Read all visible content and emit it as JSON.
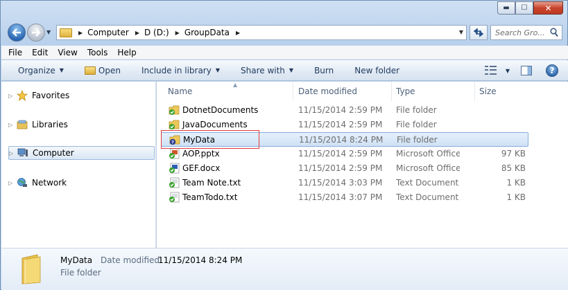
{
  "window": {
    "controls": {
      "minimize": "▬",
      "maximize": "☐",
      "close": "✕"
    }
  },
  "address": {
    "crumbs": [
      "Computer",
      "D (D:)",
      "GroupData"
    ]
  },
  "search": {
    "placeholder": "Search Gro..."
  },
  "menu": [
    "File",
    "Edit",
    "View",
    "Tools",
    "Help"
  ],
  "toolbar": {
    "organize": "Organize",
    "open": "Open",
    "include_in_library": "Include in library",
    "share_with": "Share with",
    "burn": "Burn",
    "new_folder": "New folder"
  },
  "nav_pane": {
    "items": [
      "Favorites",
      "Libraries",
      "Computer",
      "Network"
    ],
    "selected": "Computer"
  },
  "columns": {
    "name": "Name",
    "date": "Date modified",
    "type": "Type",
    "size": "Size"
  },
  "files": [
    {
      "name": "DotnetDocuments",
      "date": "11/15/2014 2:59 PM",
      "type": "File folder",
      "size": "",
      "icon": "folder-check-icon"
    },
    {
      "name": "JavaDocuments",
      "date": "11/15/2014 2:59 PM",
      "type": "File folder",
      "size": "",
      "icon": "folder-check-icon"
    },
    {
      "name": "MyData",
      "date": "11/15/2014 8:24 PM",
      "type": "File folder",
      "size": "",
      "icon": "folder-question-icon"
    },
    {
      "name": "AOP.pptx",
      "date": "11/15/2014 2:59 PM",
      "type": "Microsoft Office P...",
      "size": "97 KB",
      "icon": "pptx-check-icon"
    },
    {
      "name": "GEF.docx",
      "date": "11/15/2014 2:59 PM",
      "type": "Microsoft Office ...",
      "size": "85 KB",
      "icon": "docx-check-icon"
    },
    {
      "name": "Team Note.txt",
      "date": "11/15/2014 3:03 PM",
      "type": "Text Document",
      "size": "1 KB",
      "icon": "txt-check-icon"
    },
    {
      "name": "TeamTodo.txt",
      "date": "11/15/2014 3:07 PM",
      "type": "Text Document",
      "size": "1 KB",
      "icon": "txt-check-icon"
    }
  ],
  "details": {
    "name": "MyData",
    "date_label": "Date modified:",
    "date_value": "11/15/2014 8:24 PM",
    "type": "File folder"
  },
  "colors": {
    "accent": "#1e395b",
    "selection": "#cfe1f6",
    "highlight_box": "#e03a3a",
    "check_badge": "#3aa12e",
    "question_badge": "#2a3d8f"
  }
}
